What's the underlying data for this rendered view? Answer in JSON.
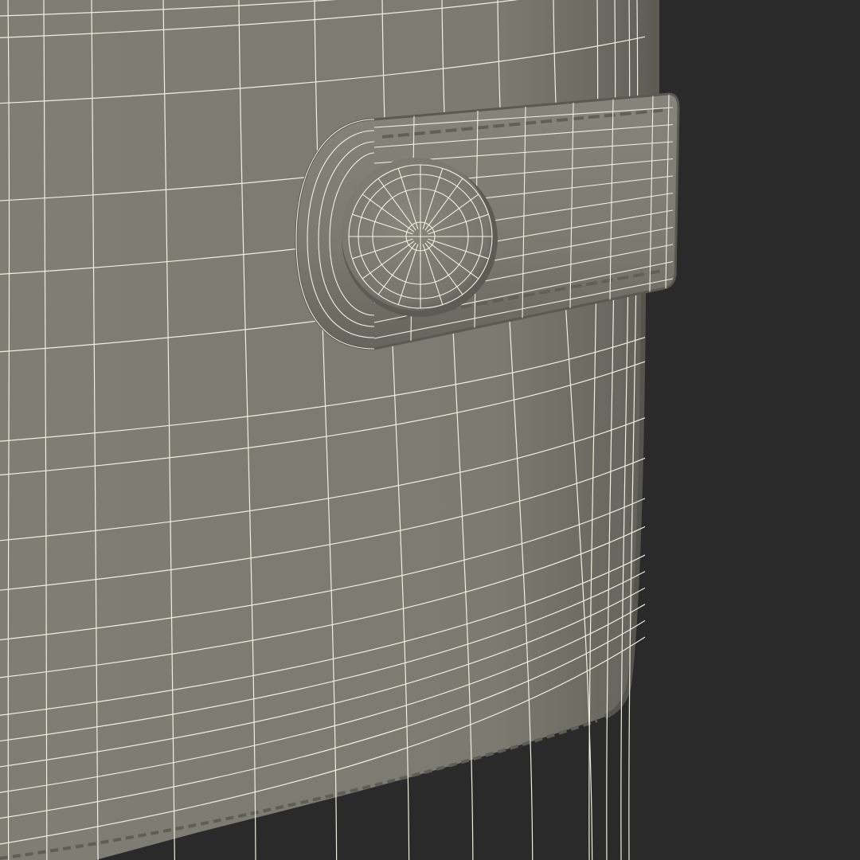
{
  "scene": {
    "subject": "wallet-wireframe-render",
    "colors": {
      "background": "#2a2a2a",
      "surface": "#7b7b71",
      "surface_shade": "#6f6f66",
      "surface_highlight": "#8a8a80",
      "wire": "#f2f0e0",
      "seam": "#5d5d55"
    }
  }
}
